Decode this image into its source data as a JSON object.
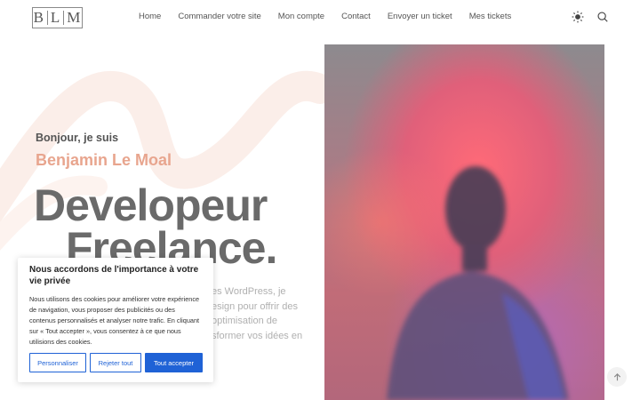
{
  "header": {
    "logo": [
      "B",
      "L",
      "M"
    ],
    "nav": [
      {
        "label": "Home"
      },
      {
        "label": "Commander votre site"
      },
      {
        "label": "Mon compte"
      },
      {
        "label": "Contact"
      },
      {
        "label": "Envoyer un ticket"
      },
      {
        "label": "Mes tickets"
      }
    ],
    "icons": [
      "sun-icon",
      "search-icon"
    ]
  },
  "hero": {
    "greeting": "Bonjour, je suis",
    "name": "Benjamin Le Moal",
    "role_line1": "Developeur",
    "role_line2": "Freelance.",
    "description_lines": [
      "es WordPress, je",
      "esign pour offrir des",
      "optimisation de",
      "sformer vos idées en"
    ]
  },
  "cookie_banner": {
    "title": "Nous accordons de l'importance à votre vie privée",
    "text": "Nous utilisons des cookies pour améliorer votre expérience de navigation, vous proposer des publicités ou des contenus personnalisés et analyser notre trafic. En cliquant sur « Tout accepter », vous consentez à ce que nous utilisions des cookies.",
    "customize_label": "Personnaliser",
    "reject_label": "Rejeter tout",
    "accept_label": "Tout accepter"
  },
  "colors": {
    "accent": "#e8a58e",
    "button_blue": "#1f62d6",
    "heading_gray": "#6a6a6a"
  }
}
